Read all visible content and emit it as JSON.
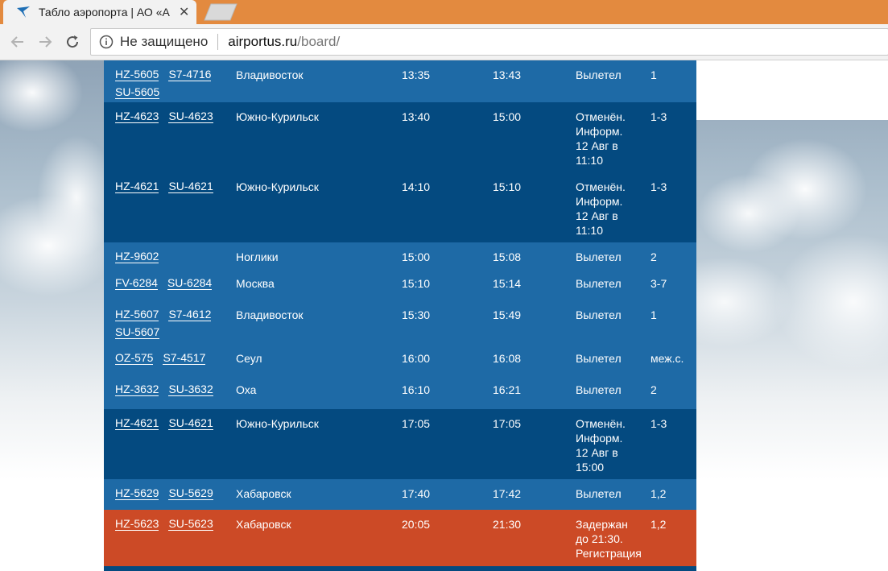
{
  "browser": {
    "tab_title": "Табло аэропорта | АО «А",
    "security_text": "Не защищено",
    "url_host": "airportus.ru",
    "url_path": "/board/",
    "accent_color": "#e38a3f"
  },
  "board": {
    "colors": {
      "light": "#1e6aa6",
      "dark": "#044a80",
      "red": "#cc4a26"
    },
    "rows": [
      {
        "flights": [
          "HZ-5605",
          "S7-4716",
          "SU-5605"
        ],
        "destination": "Владивосток",
        "scheduled": "13:35",
        "actual": "13:43",
        "status": [
          "Вылетел"
        ],
        "terminal": "1"
      },
      {
        "flights": [
          "HZ-4623",
          "SU-4623"
        ],
        "destination": "Южно-Курильск",
        "scheduled": "13:40",
        "actual": "15:00",
        "status": [
          "Отменён.",
          "Информ.",
          "12 Авг в",
          "11:10"
        ],
        "terminal": "1-3"
      },
      {
        "flights": [
          "HZ-4621",
          "SU-4621"
        ],
        "destination": "Южно-Курильск",
        "scheduled": "14:10",
        "actual": "15:10",
        "status": [
          "Отменён.",
          "Информ.",
          "12 Авг в",
          "11:10"
        ],
        "terminal": "1-3"
      },
      {
        "flights": [
          "HZ-9602"
        ],
        "destination": "Ноглики",
        "scheduled": "15:00",
        "actual": "15:08",
        "status": [
          "Вылетел"
        ],
        "terminal": "2"
      },
      {
        "flights": [
          "FV-6284",
          "SU-6284"
        ],
        "destination": "Москва",
        "scheduled": "15:10",
        "actual": "15:14",
        "status": [
          "Вылетел"
        ],
        "terminal": "3-7"
      },
      {
        "flights": [
          "HZ-5607",
          "S7-4612",
          "SU-5607"
        ],
        "destination": "Владивосток",
        "scheduled": "15:30",
        "actual": "15:49",
        "status": [
          "Вылетел"
        ],
        "terminal": "1"
      },
      {
        "flights": [
          "OZ-575",
          "S7-4517"
        ],
        "destination": "Сеул",
        "scheduled": "16:00",
        "actual": "16:08",
        "status": [
          "Вылетел"
        ],
        "terminal": "меж.с."
      },
      {
        "flights": [
          "HZ-3632",
          "SU-3632"
        ],
        "destination": "Оха",
        "scheduled": "16:10",
        "actual": "16:21",
        "status": [
          "Вылетел"
        ],
        "terminal": "2"
      },
      {
        "flights": [
          "HZ-4621",
          "SU-4621"
        ],
        "destination": "Южно-Курильск",
        "scheduled": "17:05",
        "actual": "17:05",
        "status": [
          "Отменён.",
          "Информ.",
          "12 Авг в",
          "15:00"
        ],
        "terminal": "1-3"
      },
      {
        "flights": [
          "HZ-5629",
          "SU-5629"
        ],
        "destination": "Хабаровск",
        "scheduled": "17:40",
        "actual": "17:42",
        "status": [
          "Вылетел"
        ],
        "terminal": "1,2"
      },
      {
        "flights": [
          "HZ-5623",
          "SU-5623"
        ],
        "destination": "Хабаровск",
        "scheduled": "20:05",
        "actual": "21:30",
        "status": [
          "Задержан",
          "до 21:30.",
          "Регистрация"
        ],
        "terminal": "1,2"
      }
    ]
  }
}
